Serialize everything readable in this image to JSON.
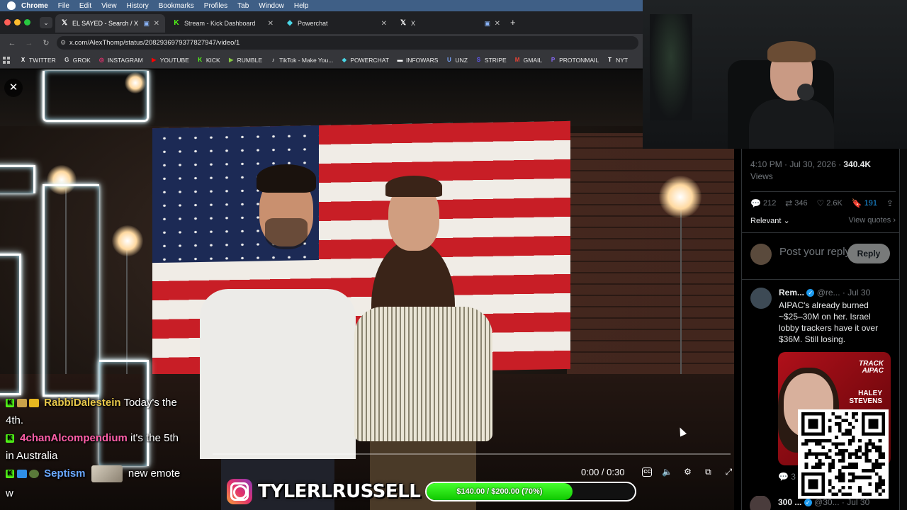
{
  "menubar": {
    "app": "Chrome",
    "items": [
      "File",
      "Edit",
      "View",
      "History",
      "Bookmarks",
      "Profiles",
      "Tab",
      "Window",
      "Help"
    ]
  },
  "tabs": [
    {
      "label": "EL SAYED - Search / X",
      "icon": "x-logo-icon"
    },
    {
      "label": "Stream - Kick Dashboard",
      "icon": "kick-logo-icon"
    },
    {
      "label": "Powerchat",
      "icon": "powerchat-icon"
    },
    {
      "label": "X",
      "icon": "x-logo-icon"
    }
  ],
  "address": {
    "url": "x.com/AlexThomp/status/2082936979377827947/video/1"
  },
  "bookmarks": [
    {
      "label": "TWITTER",
      "glyph": "X",
      "color": "#ffffff"
    },
    {
      "label": "GROK",
      "glyph": "G",
      "color": "#dddddd"
    },
    {
      "label": "INSTAGRAM",
      "glyph": "◎",
      "color": "#e1306c"
    },
    {
      "label": "YOUTUBE",
      "glyph": "▶",
      "color": "#ff0000"
    },
    {
      "label": "KICK",
      "glyph": "K",
      "color": "#53fc18"
    },
    {
      "label": "RUMBLE",
      "glyph": "▶",
      "color": "#85c742"
    },
    {
      "label": "TikTok - Make You...",
      "glyph": "♪",
      "color": "#ffffff"
    },
    {
      "label": "POWERCHAT",
      "glyph": "◆",
      "color": "#4ad6e6"
    },
    {
      "label": "INFOWARS",
      "glyph": "▬",
      "color": "#ffffff"
    },
    {
      "label": "UNZ",
      "glyph": "U",
      "color": "#7aa7ff"
    },
    {
      "label": "STRIPE",
      "glyph": "S",
      "color": "#635bff"
    },
    {
      "label": "GMAIL",
      "glyph": "M",
      "color": "#ea4335"
    },
    {
      "label": "PROTONMAIL",
      "glyph": "P",
      "color": "#8b6cff"
    },
    {
      "label": "NYT",
      "glyph": "T",
      "color": "#ffffff"
    }
  ],
  "player": {
    "time": "0:00 / 0:30",
    "close_icon": "close-icon"
  },
  "x_panel": {
    "time": "4:10 PM · Jul 30, 2026 · ",
    "views_count": "340.4K",
    "views_label": "Views",
    "replies": "212",
    "reposts": "346",
    "likes": "2.6K",
    "bookmarks": "191",
    "sort": "Relevant",
    "view_quotes": "View quotes",
    "compose_placeholder": "Post your reply",
    "reply_button": "Reply",
    "post1": {
      "name": "Rem...",
      "handle": "@re...",
      "date": "· Jul 30",
      "text": "AIPAC's already burned ~$25–30M on her. Israel lobby trackers have it over $36M. Still losing.",
      "card_brand_1": "TRACK",
      "card_brand_2": "AIPAC",
      "card_name_1": "HALEY",
      "card_name_2": "STEVENS",
      "reply_count": "3"
    },
    "post2": {
      "name": "300 ...",
      "handle": "@30...",
      "date": "· Jul 30"
    }
  },
  "chat": [
    {
      "user": "RabbiDalestein",
      "user_color": "#e8c84a",
      "message": "Today's the"
    },
    {
      "continuation": "4th."
    },
    {
      "user": "4chanAlcompendium",
      "user_color": "#ff5fa8",
      "message": "it's the 5th"
    },
    {
      "continuation": "in Australia"
    },
    {
      "user": "Septism",
      "user_color": "#6aa8ff",
      "message": "new emote"
    },
    {
      "continuation": "w"
    }
  ],
  "overlay": {
    "handle": "TYLERLRUSSELL",
    "goal_label": "$140.00 / $200.00 (70%)",
    "goal_fraction": 0.7
  }
}
